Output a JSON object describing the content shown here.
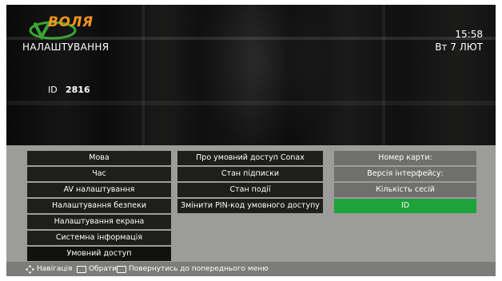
{
  "header": {
    "brand": "ВОЛЯ",
    "page_title": "НАЛАШТУВАННЯ",
    "time": "15:58",
    "date": "Вт 7 ЛЮТ",
    "id_label": "ID",
    "id_value": "2816"
  },
  "menu": {
    "items": [
      {
        "label": "Мова"
      },
      {
        "label": "Час"
      },
      {
        "label": "AV налаштування"
      },
      {
        "label": "Налаштування безпеки"
      },
      {
        "label": "Налаштування екрана"
      },
      {
        "label": "Системна інформація"
      },
      {
        "label": "Умовний доступ",
        "selected": true
      }
    ]
  },
  "submenu": {
    "items": [
      {
        "label": "Про умовний доступ Conax"
      },
      {
        "label": "Стан підписки"
      },
      {
        "label": "Стан події"
      },
      {
        "label": "Змінити PIN-код умовного доступу"
      }
    ]
  },
  "info": {
    "items": [
      {
        "label": "Номер карти:"
      },
      {
        "label": "Версія інтерфейсу:"
      },
      {
        "label": "Кількість сесій"
      },
      {
        "label": "ID",
        "highlighted": true
      }
    ]
  },
  "footer": {
    "navigate": "Навігація",
    "select": "Обрати",
    "back": "Повернутись до попереднього меню"
  },
  "colors": {
    "brand_orange": "#f7941d",
    "brand_green": "#3aa535",
    "highlight_green": "#1ea33a",
    "panel_gray": "#9c9c9a"
  }
}
